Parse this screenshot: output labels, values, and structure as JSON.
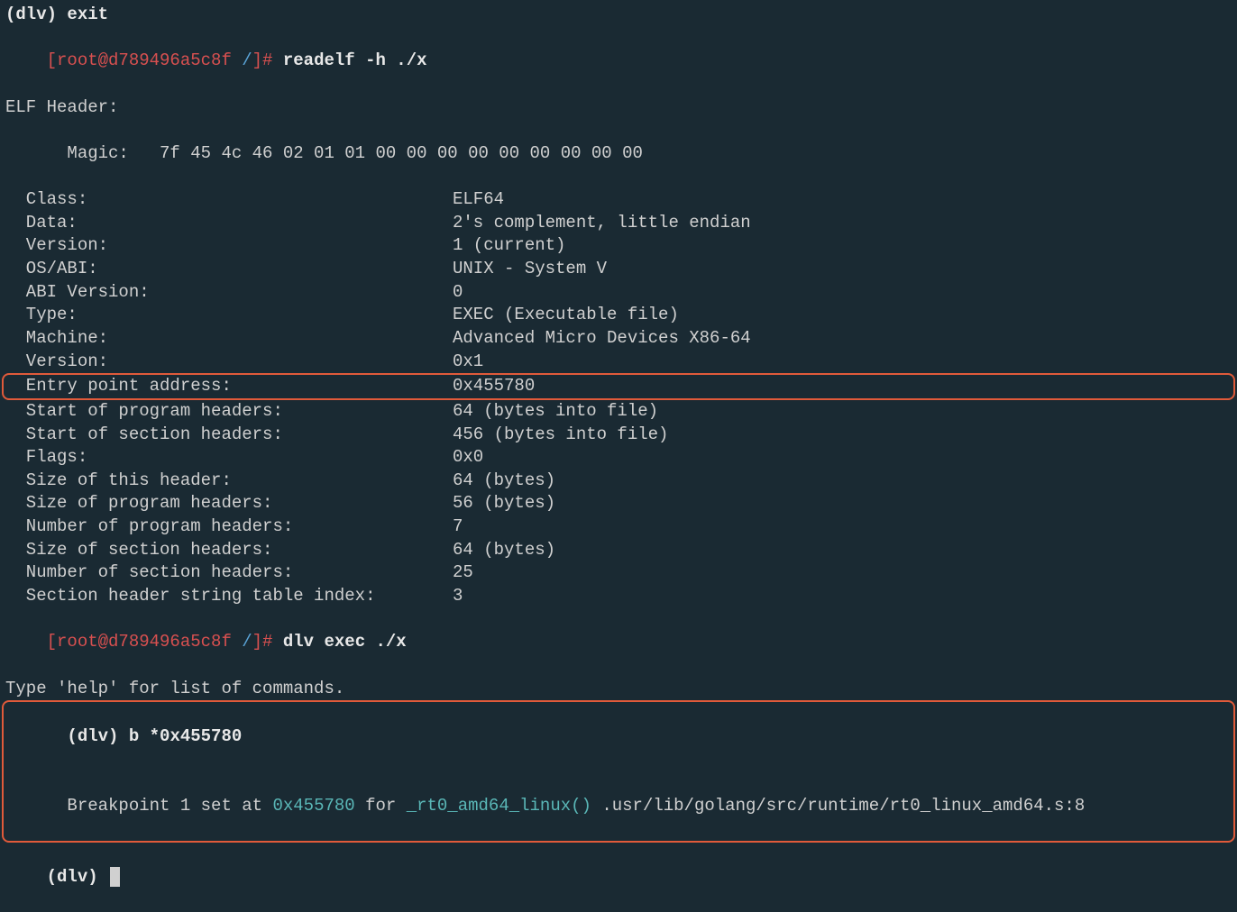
{
  "lines": {
    "top": "(dlv) exit",
    "prompt1_user": "[root@d789496a5c8f ",
    "prompt1_path": "/",
    "prompt1_end": "]# ",
    "cmd1": "readelf -h ./x",
    "prompt2_user": "[root@d789496a5c8f ",
    "prompt2_path": "/",
    "prompt2_end": "]# ",
    "cmd2": "dlv exec ./x",
    "help": "Type 'help' for list of commands.",
    "dlv_prompt": "(dlv) ",
    "dlv_cmd": "b *0x455780",
    "bp_a": "Breakpoint 1 set at ",
    "bp_addr": "0x455780",
    "bp_b": " for ",
    "bp_func": "_rt0_amd64_linux()",
    "bp_c": " .usr/lib/golang/src/runtime/rt0_linux_amd64.s:8",
    "dlv_prompt2": "(dlv) "
  },
  "elf": {
    "header_title": "ELF Header:",
    "magic_label": "  Magic:   ",
    "magic_value": "7f 45 4c 46 02 01 01 00 00 00 00 00 00 00 00 00 ",
    "rows": [
      {
        "label": "  Class:",
        "value": "ELF64"
      },
      {
        "label": "  Data:",
        "value": "2's complement, little endian"
      },
      {
        "label": "  Version:",
        "value": "1 (current)"
      },
      {
        "label": "  OS/ABI:",
        "value": "UNIX - System V"
      },
      {
        "label": "  ABI Version:",
        "value": "0"
      },
      {
        "label": "  Type:",
        "value": "EXEC (Executable file)"
      },
      {
        "label": "  Machine:",
        "value": "Advanced Micro Devices X86-64"
      },
      {
        "label": "  Version:",
        "value": "0x1"
      }
    ],
    "entry_label": "  Entry point address:",
    "entry_value": "0x455780",
    "rows2": [
      {
        "label": "  Start of program headers:",
        "value": "64 (bytes into file)"
      },
      {
        "label": "  Start of section headers:",
        "value": "456 (bytes into file)"
      },
      {
        "label": "  Flags:",
        "value": "0x0"
      },
      {
        "label": "  Size of this header:",
        "value": "64 (bytes)"
      },
      {
        "label": "  Size of program headers:",
        "value": "56 (bytes)"
      },
      {
        "label": "  Number of program headers:",
        "value": "7"
      },
      {
        "label": "  Size of section headers:",
        "value": "64 (bytes)"
      },
      {
        "label": "  Number of section headers:",
        "value": "25"
      },
      {
        "label": "  Section header string table index:",
        "value": "3"
      }
    ]
  }
}
